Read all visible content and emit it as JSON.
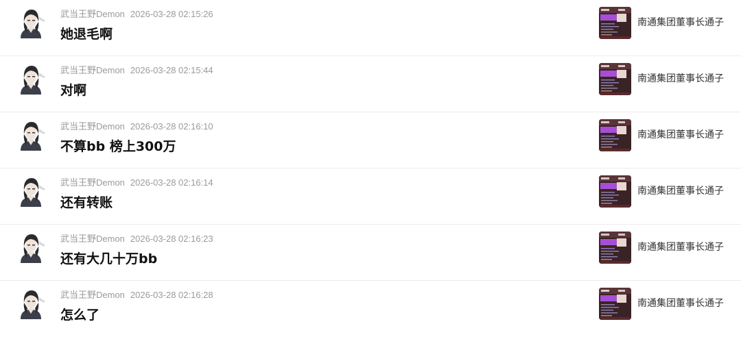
{
  "comments": [
    {
      "username": "武当王野Demon",
      "time": "2026-03-28 02:15:26",
      "text": "她退毛啊",
      "target": "南通集团董事长通子",
      "avatar_icon": "user-avatar-icon",
      "thumbnail_icon": "video-thumbnail-icon"
    },
    {
      "username": "武当王野Demon",
      "time": "2026-03-28 02:15:44",
      "text": "对啊",
      "target": "南通集团董事长通子",
      "avatar_icon": "user-avatar-icon",
      "thumbnail_icon": "video-thumbnail-icon"
    },
    {
      "username": "武当王野Demon",
      "time": "2026-03-28 02:16:10",
      "text": "不算bb  榜上300万",
      "target": "南通集团董事长通子",
      "avatar_icon": "user-avatar-icon",
      "thumbnail_icon": "video-thumbnail-icon"
    },
    {
      "username": "武当王野Demon",
      "time": "2026-03-28 02:16:14",
      "text": "还有转账",
      "target": "南通集团董事长通子",
      "avatar_icon": "user-avatar-icon",
      "thumbnail_icon": "video-thumbnail-icon"
    },
    {
      "username": "武当王野Demon",
      "time": "2026-03-28 02:16:23",
      "text": "还有大几十万bb",
      "target": "南通集团董事长通子",
      "avatar_icon": "user-avatar-icon",
      "thumbnail_icon": "video-thumbnail-icon"
    },
    {
      "username": "武当王野Demon",
      "time": "2026-03-28 02:16:28",
      "text": "怎么了",
      "target": "南通集团董事长通子",
      "avatar_icon": "user-avatar-icon",
      "thumbnail_icon": "video-thumbnail-icon"
    }
  ],
  "colors": {
    "meta_text": "#9a9a9a",
    "message_text": "#111111",
    "divider": "#ececec",
    "thumbnail_bg": "#3a2326",
    "thumbnail_accent": "#a64fd6"
  }
}
